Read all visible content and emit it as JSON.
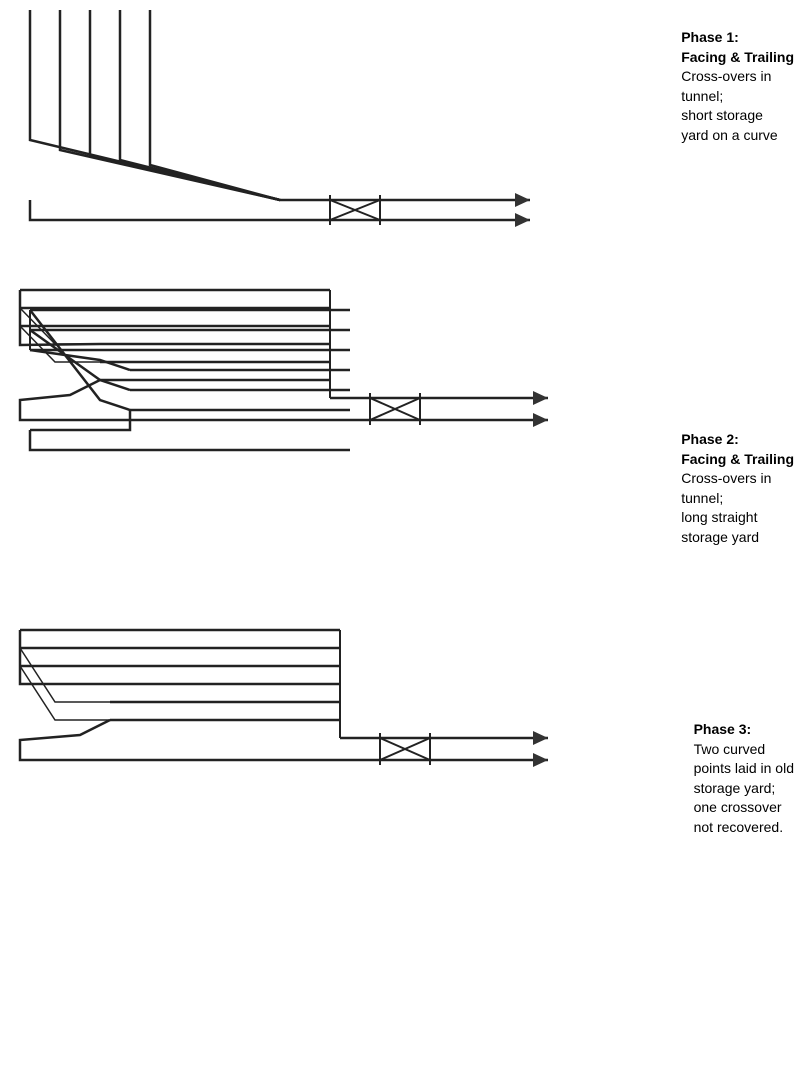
{
  "labels": {
    "phase1": {
      "title": "Phase 1:",
      "line1": "Facing & Trailing",
      "line2": "Cross-overs in",
      "line3": "tunnel;",
      "line4": "short storage",
      "line5": "yard on a curve"
    },
    "phase2": {
      "title": "Phase 2:",
      "line1": "Facing & Trailing",
      "line2": "Cross-overs in",
      "line3": "tunnel;",
      "line4": "long straight",
      "line5": "storage yard"
    },
    "phase3": {
      "title": "Phase 3:",
      "line1": "Two curved",
      "line2": "points laid in old",
      "line3": "storage yard;",
      "line4": "one crossover",
      "line5": "not recovered."
    }
  }
}
